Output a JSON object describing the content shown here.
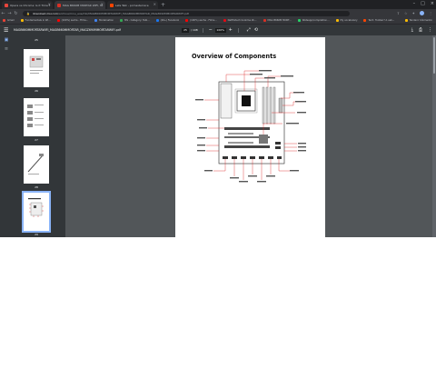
{
  "tabs": [
    {
      "label": "Opera vs Chrome: Is it Time to Switch?",
      "color": "#e8453c"
    },
    {
      "label": "MAG B660M MORTAR WIFI, MAG B...",
      "color": "#d93025",
      "active": true
    },
    {
      "label": "Lets Talk - pcmasterrace",
      "color": "#ff4500"
    }
  ],
  "address": {
    "host": "download.msi.com",
    "path": "/archive/mnu_exe/mb/MAGB660MMORTARWIFI_MAGB660MMORTAR_MAGZ690MMORTARWIFI.pdf"
  },
  "bookmarks": [
    {
      "label": "Gmail",
      "color": "#ea4335"
    },
    {
      "label": "Fundamentals in Wi...",
      "color": "#fbbc04"
    },
    {
      "label": "(100%) ascha - Films...",
      "color": "#ff0000"
    },
    {
      "label": "Modelnation",
      "color": "#4285f4"
    },
    {
      "label": "MS - Category: Tabl...",
      "color": "#34a853"
    },
    {
      "label": "(26+) Facebook",
      "color": "#1877f2"
    },
    {
      "label": "(100%) ascha - Films...",
      "color": "#ff0000"
    },
    {
      "label": "Netflixtech bookme 2k...",
      "color": "#e50914"
    },
    {
      "label": "MAG B660M MORT...",
      "color": "#d93025"
    },
    {
      "label": "Watsapp/compilation...",
      "color": "#25d366"
    },
    {
      "label": "My vocabulary",
      "color": "#fbbc04"
    },
    {
      "label": "Tech: Toolbar? A usb...",
      "color": "#ff4500"
    }
  ],
  "other_bookmarks": "Tenders' bókmerkin",
  "pdf": {
    "title": "MAGB660MMORTARWIFI_MAGB660MMORTAR_MAGZ690MMORTARWIFI.pdf",
    "page": "25",
    "total": "/ 108",
    "zoom": "100%"
  },
  "thumbnails": [
    {
      "num": "25"
    },
    {
      "num": "26"
    },
    {
      "num": "27"
    },
    {
      "num": "28"
    },
    {
      "num": "29",
      "selected": true
    }
  ],
  "page_content": {
    "title": "Overview of Components"
  }
}
